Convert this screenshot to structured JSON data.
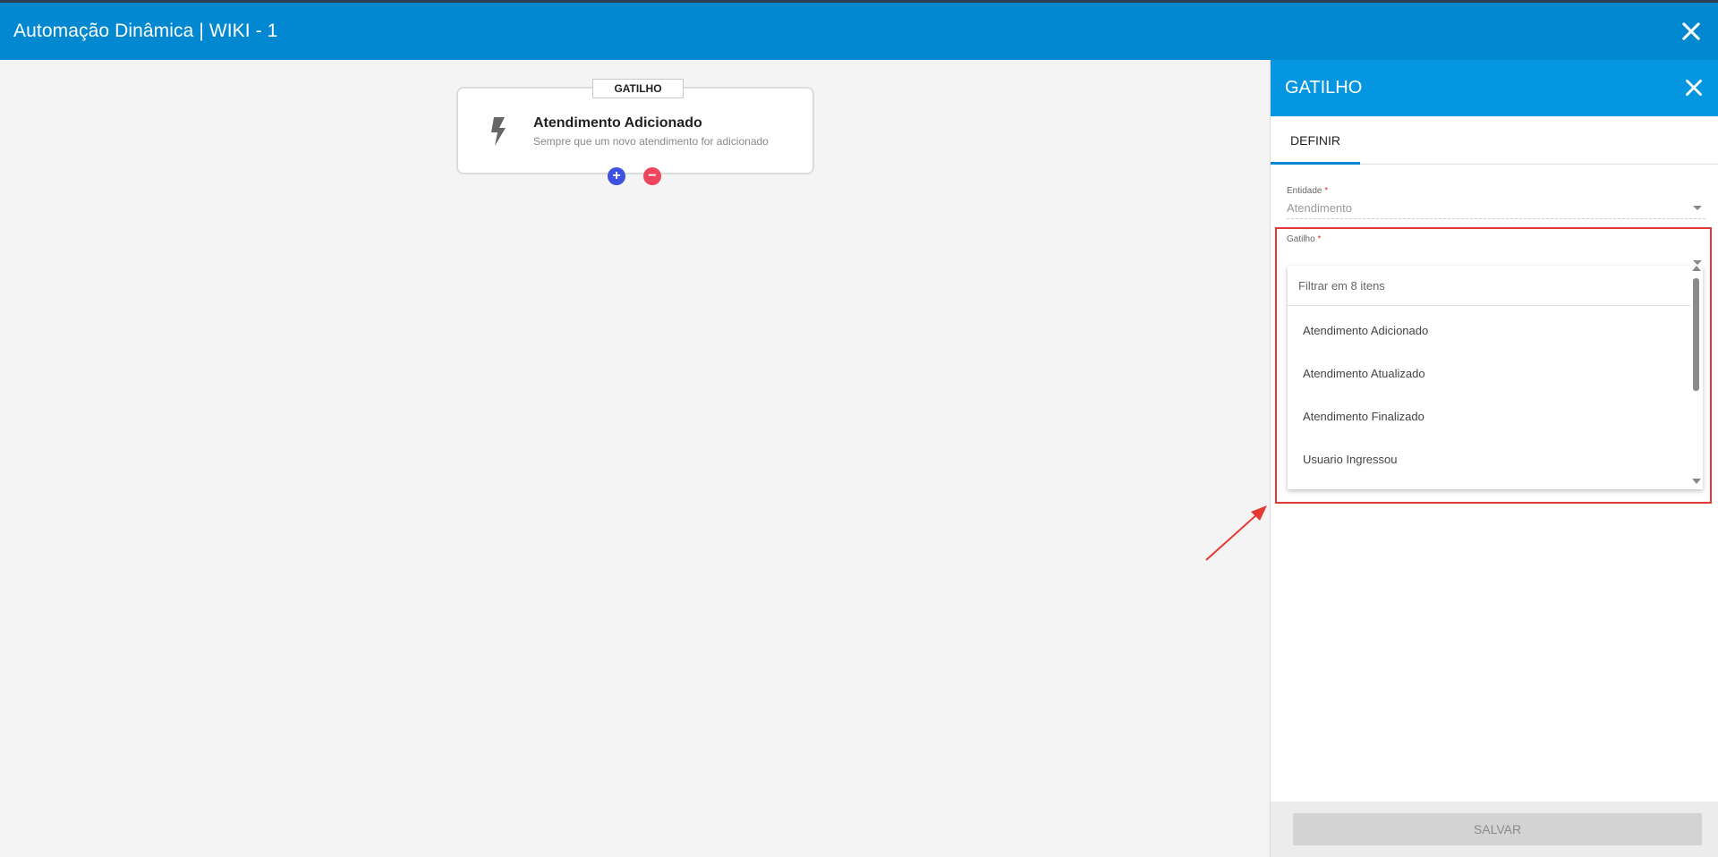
{
  "window": {
    "title": "Automação Dinâmica | WIKI - 1"
  },
  "node": {
    "tag": "GATILHO",
    "title": "Atendimento Adicionado",
    "subtitle": "Sempre que um novo atendimento for adicionado",
    "add_label": "+",
    "remove_label": "−",
    "icon": "lightning-icon"
  },
  "panel": {
    "title": "GATILHO",
    "tabs": [
      {
        "label": "DEFINIR",
        "active": true
      }
    ],
    "entidade": {
      "label": "Entidade",
      "required_mark": "*",
      "value": "Atendimento"
    },
    "gatilho": {
      "label": "Gatilho",
      "required_mark": "*",
      "value": ""
    },
    "dropdown": {
      "search_placeholder": "Filtrar em 8 itens",
      "items": [
        "Atendimento Adicionado",
        "Atendimento Atualizado",
        "Atendimento Finalizado",
        "Usuario Ingressou"
      ]
    },
    "save_label": "SALVAR"
  },
  "colors": {
    "topbar": "#0288d1",
    "panel_header": "#0496e0",
    "highlight": "#e53935",
    "add": "#3f51e0",
    "remove": "#f0455f"
  }
}
